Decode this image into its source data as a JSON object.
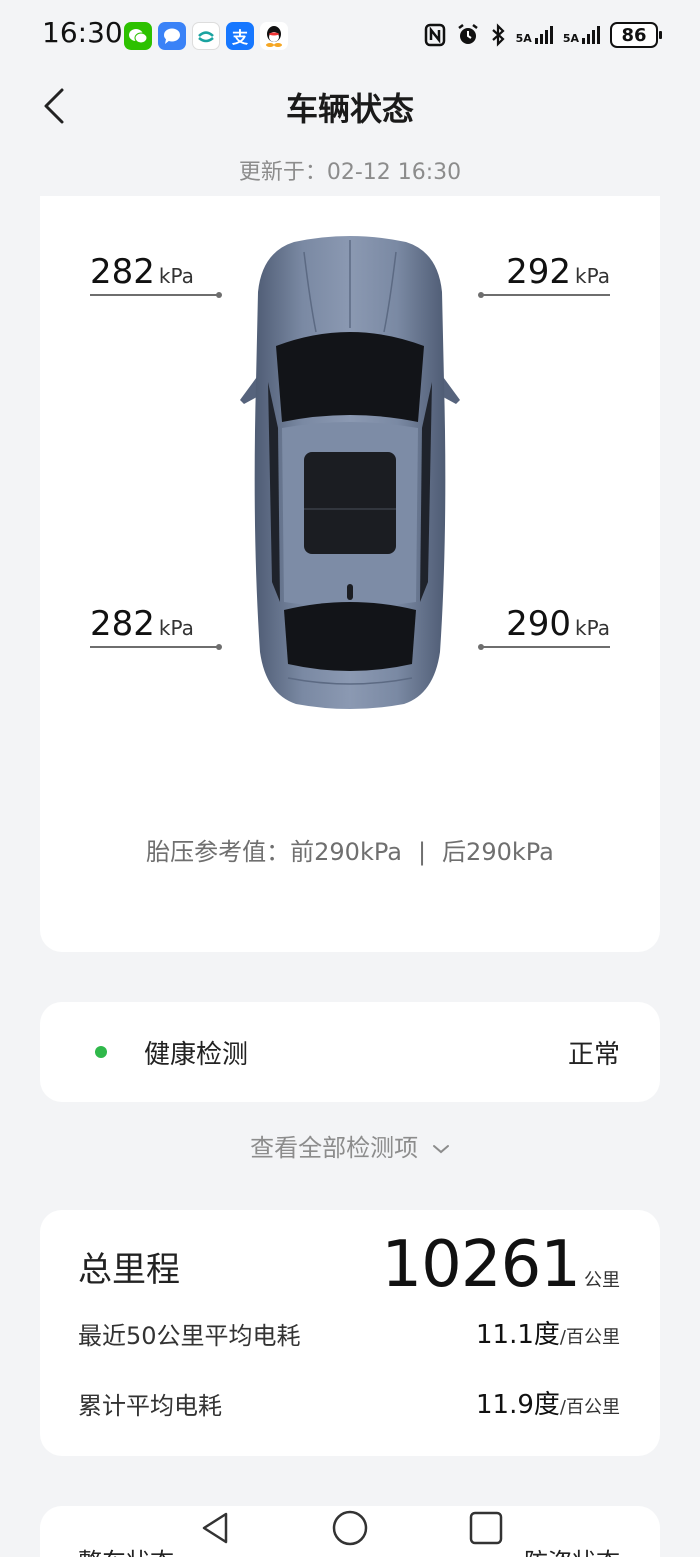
{
  "status_bar": {
    "time": "16:30",
    "battery": "86",
    "network_1": "5A",
    "network_2": "5A",
    "apps": [
      "wechat-icon",
      "messages-icon",
      "china-mobile-icon",
      "alipay-icon",
      "qq-icon"
    ],
    "alipay_glyph": "支"
  },
  "header": {
    "title": "车辆状态",
    "updated": "更新于：02-12 16:30"
  },
  "tires": {
    "front_left": "282",
    "front_right": "292",
    "rear_left": "282",
    "rear_right": "290",
    "unit": "kPa"
  },
  "reference": {
    "label": "胎压参考值：",
    "front": "前290kPa",
    "separator": "|",
    "rear": "后290kPa"
  },
  "health": {
    "label": "健康检测",
    "status": "正常",
    "status_color": "#2fb84a"
  },
  "view_all": "查看全部检测项",
  "mileage": {
    "total_label": "总里程",
    "total_value": "10261",
    "total_unit": "公里",
    "recent_label": "最近50公里平均电耗",
    "recent_value": "11.1度",
    "recent_unit": "/百公里",
    "cumulative_label": "累计平均电耗",
    "cumulative_value": "11.9度",
    "cumulative_unit": "/百公里"
  },
  "bottom": {
    "left_label": "整车状态",
    "right_label": "防盗状态"
  },
  "colors": {
    "car_body": "#6b7a94",
    "background": "#f3f4f6",
    "card": "#ffffff"
  }
}
